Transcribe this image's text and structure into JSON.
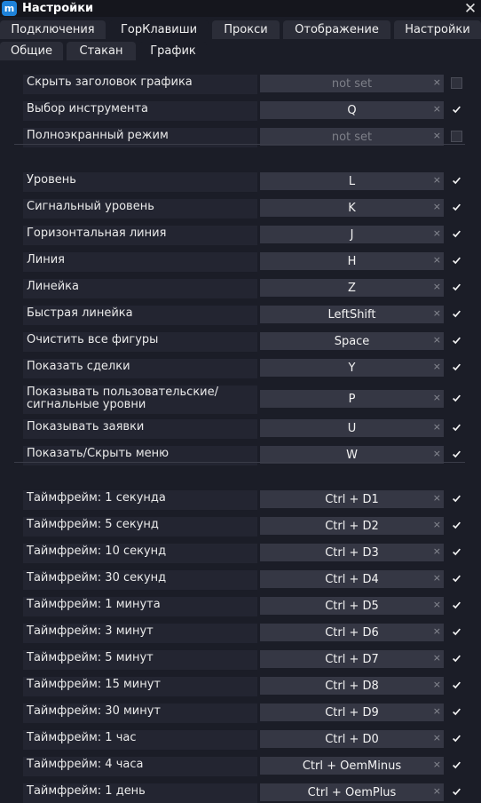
{
  "window": {
    "title": "Настройки",
    "app_icon_letter": "m"
  },
  "tabs_row1": [
    "Подключения",
    "ГорКлавиши",
    "Прокси",
    "Отображение",
    "Настройки"
  ],
  "tabs_row2": [
    "Общие",
    "Стакан",
    "График"
  ],
  "clear_glyph": "×",
  "groups": [
    {
      "rows": [
        {
          "label": "Скрыть заголовок графика",
          "key": "not set",
          "enabled": false
        },
        {
          "label": "Выбор инструмента",
          "key": "Q",
          "enabled": true
        },
        {
          "label": "Полноэкранный режим",
          "key": "not set",
          "enabled": false
        }
      ]
    },
    {
      "rows": [
        {
          "label": "Уровень",
          "key": "L",
          "enabled": true
        },
        {
          "label": "Сигнальный уровень",
          "key": "K",
          "enabled": true
        },
        {
          "label": "Горизонтальная линия",
          "key": "J",
          "enabled": true
        },
        {
          "label": "Линия",
          "key": "H",
          "enabled": true
        },
        {
          "label": "Линейка",
          "key": "Z",
          "enabled": true
        },
        {
          "label": "Быстрая линейка",
          "key": "LeftShift",
          "enabled": true
        },
        {
          "label": "Очистить все фигуры",
          "key": "Space",
          "enabled": true
        },
        {
          "label": "Показать сделки",
          "key": "Y",
          "enabled": true
        },
        {
          "label": "Показывать пользовательские/ сигнальные уровни",
          "key": "P",
          "enabled": true
        },
        {
          "label": "Показывать заявки",
          "key": "U",
          "enabled": true
        },
        {
          "label": "Показать/Скрыть меню",
          "key": "W",
          "enabled": true
        }
      ]
    },
    {
      "rows": [
        {
          "label": "Таймфрейм: 1 секунда",
          "key": "Ctrl + D1",
          "enabled": true
        },
        {
          "label": "Таймфрейм: 5 секунд",
          "key": "Ctrl + D2",
          "enabled": true
        },
        {
          "label": "Таймфрейм: 10 секунд",
          "key": "Ctrl + D3",
          "enabled": true
        },
        {
          "label": "Таймфрейм: 30 секунд",
          "key": "Ctrl + D4",
          "enabled": true
        },
        {
          "label": "Таймфрейм: 1 минута",
          "key": "Ctrl + D5",
          "enabled": true
        },
        {
          "label": "Таймфрейм: 3 минут",
          "key": "Ctrl + D6",
          "enabled": true
        },
        {
          "label": "Таймфрейм: 5 минут",
          "key": "Ctrl + D7",
          "enabled": true
        },
        {
          "label": "Таймфрейм: 15 минут",
          "key": "Ctrl + D8",
          "enabled": true
        },
        {
          "label": "Таймфрейм: 30 минут",
          "key": "Ctrl + D9",
          "enabled": true
        },
        {
          "label": "Таймфрейм: 1 час",
          "key": "Ctrl + D0",
          "enabled": true
        },
        {
          "label": "Таймфрейм: 4 часа",
          "key": "Ctrl + OemMinus",
          "enabled": true
        },
        {
          "label": "Таймфрейм: 1 день",
          "key": "Ctrl + OemPlus",
          "enabled": true
        }
      ]
    }
  ]
}
